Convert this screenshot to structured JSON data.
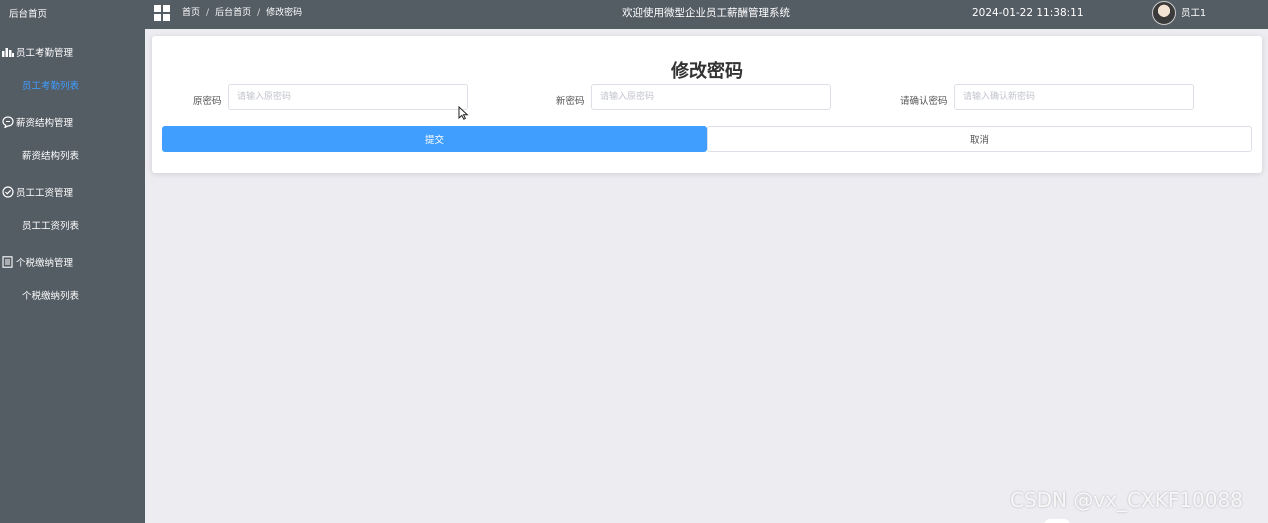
{
  "sidebar": {
    "home": "后台首页",
    "groups": [
      {
        "label": "员工考勤管理",
        "icon": "bar-chart-icon",
        "sub": "员工考勤列表",
        "active": true
      },
      {
        "label": "薪资结构管理",
        "icon": "chat-bubble-icon",
        "sub": "薪资结构列表",
        "active": false
      },
      {
        "label": "员工工资管理",
        "icon": "check-circle-icon",
        "sub": "员工工资列表",
        "active": false
      },
      {
        "label": "个税缴纳管理",
        "icon": "document-icon",
        "sub": "个税缴纳列表",
        "active": false
      }
    ]
  },
  "header": {
    "breadcrumb": [
      "首页",
      "后台首页",
      "修改密码"
    ],
    "breadcrumb_separator": "/",
    "system_title": "欢迎使用微型企业员工薪酬管理系统",
    "datetime": "2024-01-22 11:38:11",
    "username": "员工1"
  },
  "form": {
    "title": "修改密码",
    "fields": [
      {
        "label": "原密码",
        "placeholder": "请输入原密码",
        "value": ""
      },
      {
        "label": "新密码",
        "placeholder": "请输入原密码",
        "value": ""
      },
      {
        "label": "请确认密码",
        "placeholder": "请输入确认新密码",
        "value": ""
      }
    ],
    "submit_label": "提交",
    "cancel_label": "取消"
  },
  "watermark": "CSDN @vx_CXKF10088",
  "colors": {
    "sidebar_bg": "#545c64",
    "accent": "#409eff",
    "page_bg": "#edecf1"
  }
}
